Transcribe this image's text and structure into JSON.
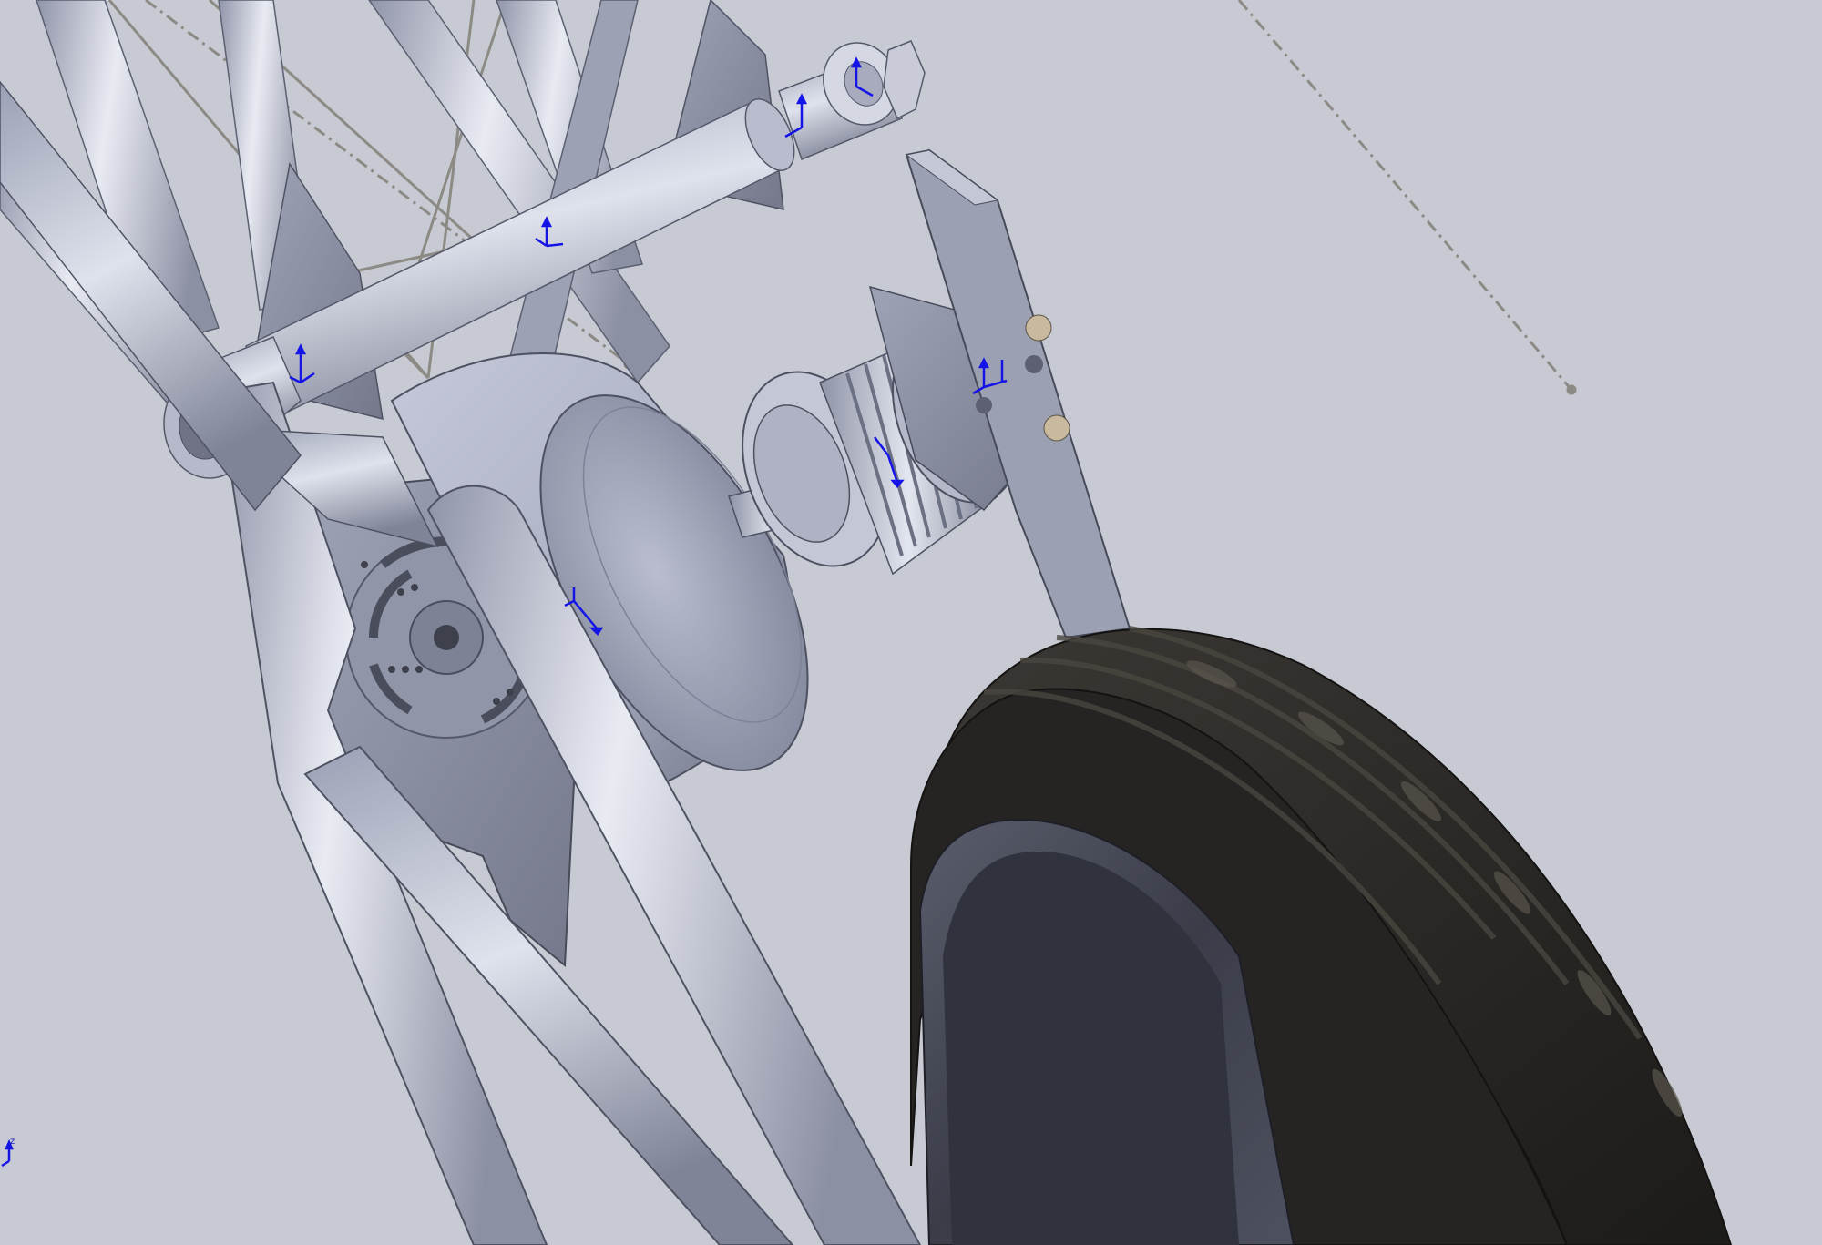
{
  "viewport": {
    "background": "#c7cad3",
    "metal_color": "#aeb3c4",
    "tire_color": "#2a2826",
    "triad_color": "#1414e6",
    "sketch_line_color": "#8c8a84"
  },
  "triad": {
    "label": "z"
  },
  "model": {
    "components": [
      "frame-tubes",
      "upper-axle",
      "hub-motor",
      "timing-pulley",
      "motor-mount-plate",
      "tensioner-bracket",
      "rear-tire"
    ]
  }
}
